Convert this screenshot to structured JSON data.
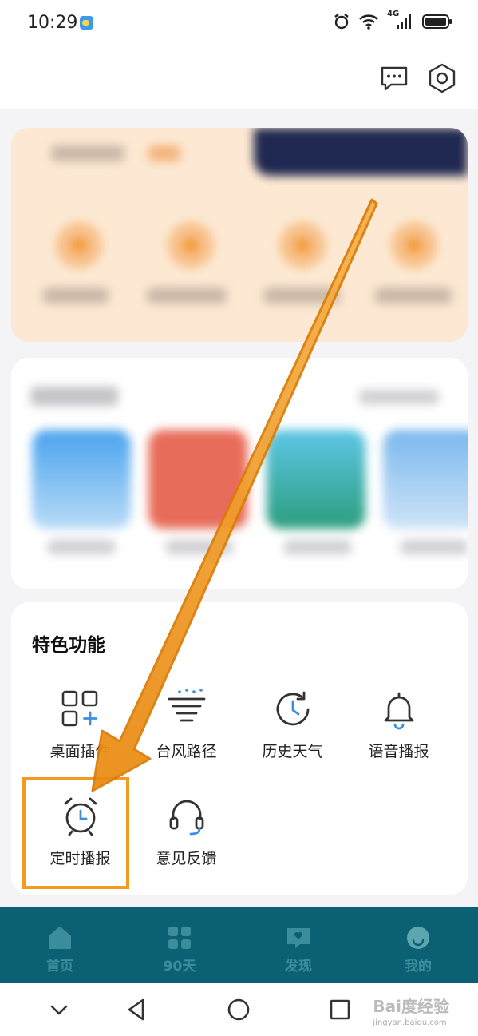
{
  "status_bar": {
    "time": "10:29",
    "network": "4G"
  },
  "feature_section": {
    "title": "特色功能",
    "items": [
      {
        "label": "桌面插件",
        "icon": "widget-add-icon"
      },
      {
        "label": "台风路径",
        "icon": "typhoon-icon"
      },
      {
        "label": "历史天气",
        "icon": "history-clock-icon"
      },
      {
        "label": "语音播报",
        "icon": "bell-icon"
      },
      {
        "label": "定时播报",
        "icon": "alarm-clock-icon"
      },
      {
        "label": "意见反馈",
        "icon": "headset-icon"
      }
    ]
  },
  "tabbar": {
    "tabs": [
      {
        "label": "首页",
        "icon": "home-icon"
      },
      {
        "label": "90天",
        "icon": "grid-icon"
      },
      {
        "label": "发现",
        "icon": "discover-icon"
      },
      {
        "label": "我的",
        "icon": "profile-icon"
      }
    ]
  },
  "watermark": {
    "text": "Bai度经验",
    "sub": "jingyan.baidu.com"
  },
  "colors": {
    "accent": "#3d8fe0",
    "tabbar": "#0b6173",
    "annotation": "#f39a20"
  }
}
